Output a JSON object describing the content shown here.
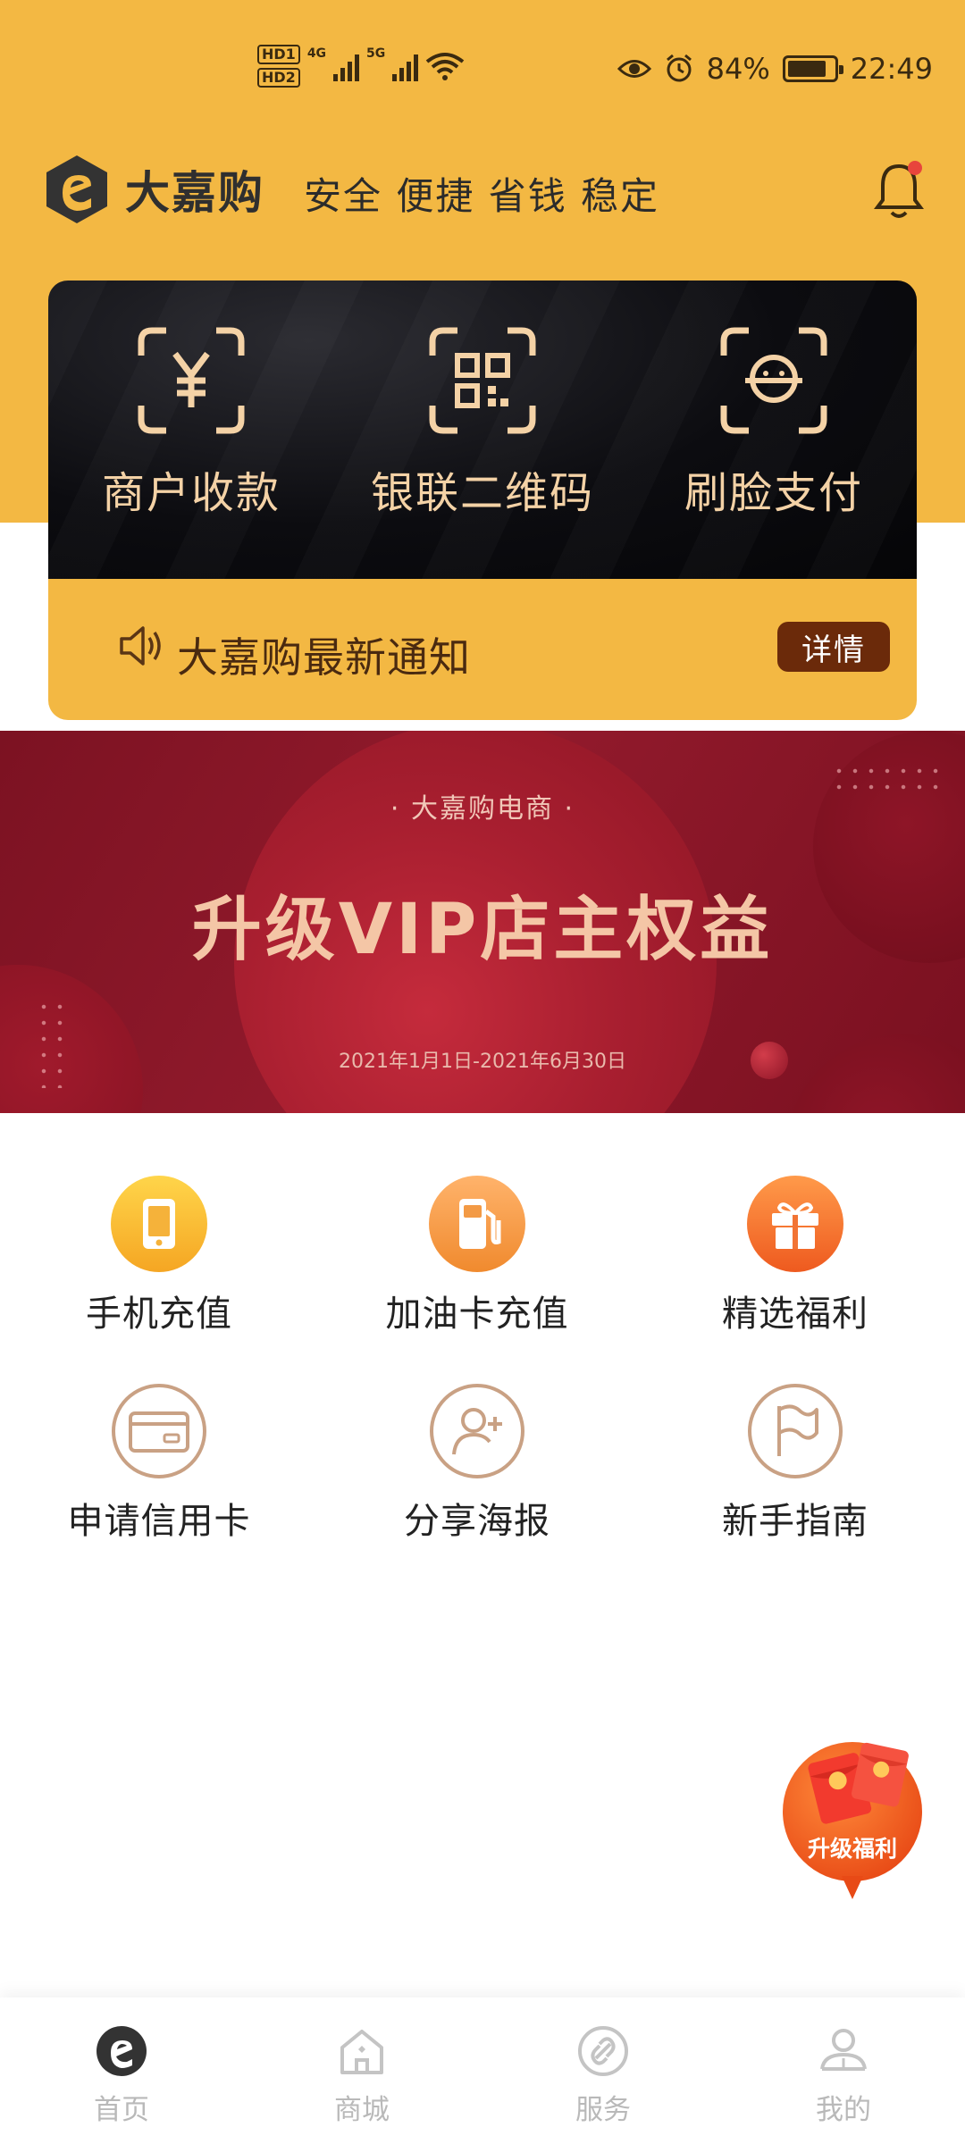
{
  "status_bar": {
    "hd1": "HD1",
    "hd2": "HD2",
    "net1": "4G",
    "net2": "5G",
    "battery": "84%",
    "time": "22:49"
  },
  "header": {
    "brand": "大嘉购",
    "slogan": "安全 便捷 省钱 稳定",
    "notification_dot_color": "#E8453C"
  },
  "payment": {
    "items": [
      {
        "label": "商户收款",
        "icon": "yuan-scan-icon"
      },
      {
        "label": "银联二维码",
        "icon": "qr-code-icon"
      },
      {
        "label": "刷脸支付",
        "icon": "face-scan-icon"
      }
    ]
  },
  "notice": {
    "text": "大嘉购最新通知",
    "button": "详情"
  },
  "banner": {
    "subtitle": "· 大嘉购电商 ·",
    "title": "升级VIP店主权益",
    "date_range": "2021年1月1日-2021年6月30日"
  },
  "services": {
    "row1": [
      {
        "label": "手机充值",
        "icon": "phone-icon"
      },
      {
        "label": "加油卡充值",
        "icon": "fuel-pump-icon"
      },
      {
        "label": "精选福利",
        "icon": "gift-icon"
      }
    ],
    "row2": [
      {
        "label": "申请信用卡",
        "icon": "credit-card-icon"
      },
      {
        "label": "分享海报",
        "icon": "add-user-icon"
      },
      {
        "label": "新手指南",
        "icon": "flag-icon"
      }
    ]
  },
  "floating": {
    "label": "升级福利"
  },
  "tabbar": {
    "tabs": [
      {
        "label": "首页",
        "icon": "home-logo-icon",
        "active": true
      },
      {
        "label": "商城",
        "icon": "mall-icon"
      },
      {
        "label": "服务",
        "icon": "link-icon"
      },
      {
        "label": "我的",
        "icon": "profile-icon"
      }
    ]
  },
  "colors": {
    "brand_yellow": "#F3B843",
    "pay_text": "#F4D2A6",
    "notice_button": "#6B2A0A",
    "banner_red": "#921A2C"
  }
}
